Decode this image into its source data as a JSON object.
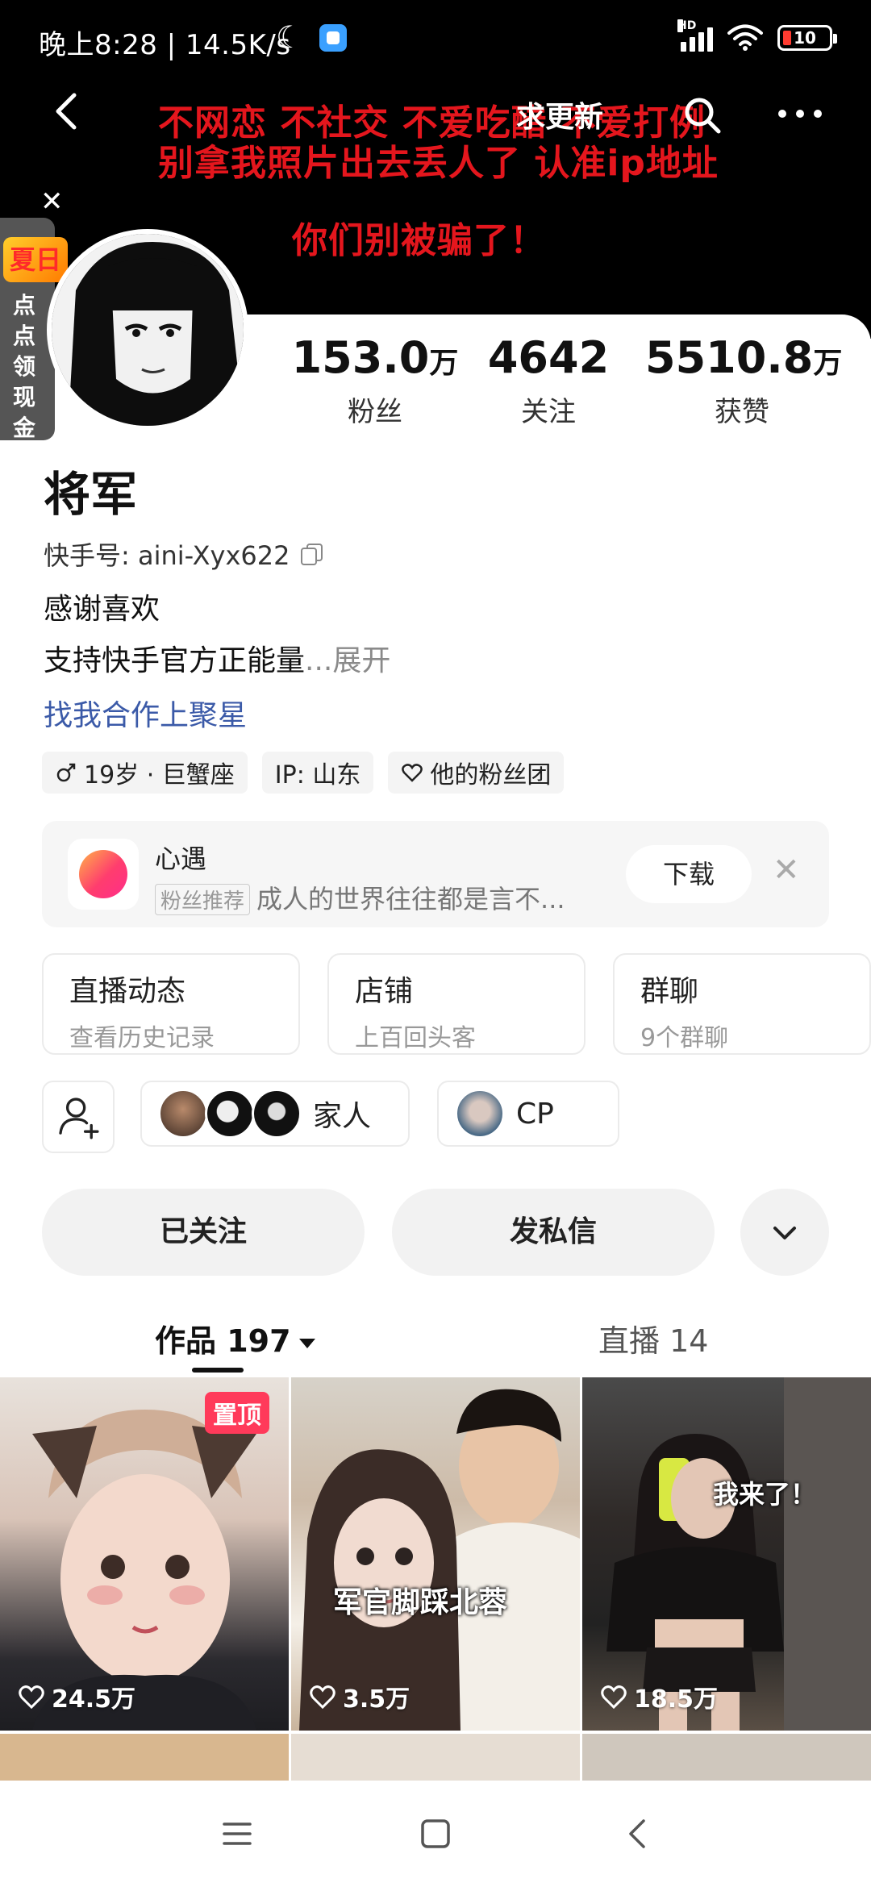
{
  "status_bar": {
    "time": "晚上8:28 | 14.5K/s",
    "battery": "10",
    "signal_label": "HD"
  },
  "header": {
    "banner_line1": "不网恋 不社交 不爱吃醋 不爱打例",
    "banner_line2": "别拿我照片出去丢人了 认准ip地址",
    "banner_line3": "你们别被骗了！",
    "update_label": "求更新",
    "close_glyph": "✕"
  },
  "side_promo": {
    "badge": "夏日",
    "text": "点点领现金"
  },
  "stats": [
    {
      "num": "153.0",
      "unit": "万",
      "label": "粉丝"
    },
    {
      "num": "4642",
      "unit": "",
      "label": "关注"
    },
    {
      "num": "5510.8",
      "unit": "万",
      "label": "获赞"
    }
  ],
  "profile": {
    "name": "将军",
    "kuaishou_id": "快手号: aini-Xyx622",
    "bio_line1": "感谢喜欢",
    "bio_line2": "支持快手官方正能量",
    "bio_expand": "...展开",
    "collab_link": "找我合作上聚星"
  },
  "tags": {
    "age": "19岁 · 巨蟹座",
    "ip": "IP: 山东",
    "fan_club": "他的粉丝团"
  },
  "promo": {
    "title": "心遇",
    "badge": "粉丝推荐",
    "subtitle": "成人的世界往往都是言不...",
    "download": "下载",
    "close_glyph": "✕"
  },
  "feature_cards": [
    {
      "title": "直播动态",
      "sub": "查看历史记录"
    },
    {
      "title": "店铺",
      "sub": "上百回头客"
    },
    {
      "title": "群聊",
      "sub": "9个群聊"
    }
  ],
  "friend_groups": {
    "family": "家人",
    "cp": "CP"
  },
  "actions": {
    "following": "已关注",
    "message": "发私信"
  },
  "tabs": {
    "works": "作品 197",
    "live": "直播 14"
  },
  "videos": [
    {
      "likes": "24.5万",
      "pinned": "置顶",
      "caption": ""
    },
    {
      "likes": "3.5万",
      "pinned": "",
      "caption": "军官脚踩北蓉"
    },
    {
      "likes": "18.5万",
      "pinned": "",
      "caption": "我来了！"
    }
  ],
  "colors": {
    "banner_text": "#e4161d",
    "link": "#3b5aa8",
    "pin_badge": "#ff3a5a"
  }
}
